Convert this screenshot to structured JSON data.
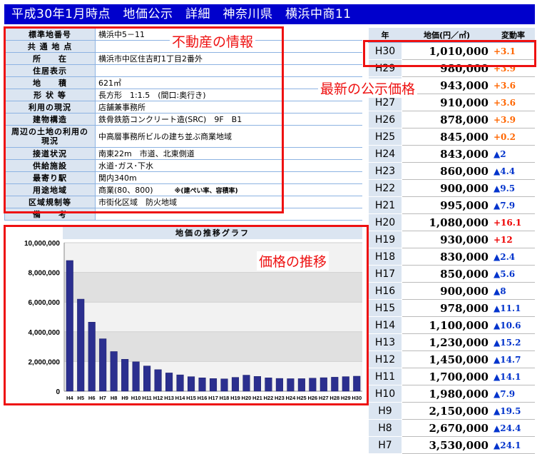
{
  "header": {
    "title": "平成30年1月時点　地価公示　詳細　神奈川県　横浜中商11"
  },
  "property": [
    {
      "label": "標準地番号",
      "value": "横浜中5－11"
    },
    {
      "label": "共 通 地 点",
      "value": ""
    },
    {
      "label": "所　　在",
      "value": "横浜市中区住吉町1丁目2番外"
    },
    {
      "label": "住居表示",
      "value": ""
    },
    {
      "label": "地　　積",
      "value": "621㎡"
    },
    {
      "label": "形 状 等",
      "value": "長方形　1:1.5　(間口:奥行き)"
    },
    {
      "label": "利用の現況",
      "value": "店舗兼事務所"
    },
    {
      "label": "建物構造",
      "value": "鉄骨鉄筋コンクリート造(SRC)　9F　B1"
    },
    {
      "label": "周辺の土地の利用の現況",
      "value": "中高層事務所ビルの建ち並ぶ商業地域"
    },
    {
      "label": "接道状況",
      "value": "南東22m　市道、北東側道"
    },
    {
      "label": "供給施設",
      "value": "水道･ガス･下水"
    },
    {
      "label": "最寄り駅",
      "value": "関内340m"
    },
    {
      "label": "用途地域",
      "value": "商業(80、800)",
      "note": "※(建ぺい率、容積率)"
    },
    {
      "label": "区域規制等",
      "value": "市街化区域　防火地域"
    },
    {
      "label": "備　　考",
      "value": ""
    }
  ],
  "price_table": {
    "headers": [
      "年",
      "地価(円／㎡)",
      "変動率"
    ],
    "rows": [
      {
        "year": "H30",
        "price": "1,010,000",
        "change": "+3.1",
        "dir": "up"
      },
      {
        "year": "H29",
        "price": "980,000",
        "change": "+3.9",
        "dir": "up"
      },
      {
        "year": "H28",
        "price": "943,000",
        "change": "+3.6",
        "dir": "up"
      },
      {
        "year": "H27",
        "price": "910,000",
        "change": "+3.6",
        "dir": "up"
      },
      {
        "year": "H26",
        "price": "878,000",
        "change": "+3.9",
        "dir": "up"
      },
      {
        "year": "H25",
        "price": "845,000",
        "change": "+0.2",
        "dir": "up"
      },
      {
        "year": "H24",
        "price": "843,000",
        "change": "▲2",
        "dir": "down"
      },
      {
        "year": "H23",
        "price": "860,000",
        "change": "▲4.4",
        "dir": "down"
      },
      {
        "year": "H22",
        "price": "900,000",
        "change": "▲9.5",
        "dir": "down"
      },
      {
        "year": "H21",
        "price": "995,000",
        "change": "▲7.9",
        "dir": "down"
      },
      {
        "year": "H20",
        "price": "1,080,000",
        "change": "+16.1",
        "dir": "upred"
      },
      {
        "year": "H19",
        "price": "930,000",
        "change": "+12",
        "dir": "upred"
      },
      {
        "year": "H18",
        "price": "830,000",
        "change": "▲2.4",
        "dir": "down"
      },
      {
        "year": "H17",
        "price": "850,000",
        "change": "▲5.6",
        "dir": "down"
      },
      {
        "year": "H16",
        "price": "900,000",
        "change": "▲8",
        "dir": "down"
      },
      {
        "year": "H15",
        "price": "978,000",
        "change": "▲11.1",
        "dir": "down"
      },
      {
        "year": "H14",
        "price": "1,100,000",
        "change": "▲10.6",
        "dir": "down"
      },
      {
        "year": "H13",
        "price": "1,230,000",
        "change": "▲15.2",
        "dir": "down"
      },
      {
        "year": "H12",
        "price": "1,450,000",
        "change": "▲14.7",
        "dir": "down"
      },
      {
        "year": "H11",
        "price": "1,700,000",
        "change": "▲14.1",
        "dir": "down"
      },
      {
        "year": "H10",
        "price": "1,980,000",
        "change": "▲7.9",
        "dir": "down"
      },
      {
        "year": "H9",
        "price": "2,150,000",
        "change": "▲19.5",
        "dir": "down"
      },
      {
        "year": "H8",
        "price": "2,670,000",
        "change": "▲24.4",
        "dir": "down"
      },
      {
        "year": "H7",
        "price": "3,530,000",
        "change": "▲24.1",
        "dir": "down"
      }
    ]
  },
  "annotations": {
    "property_info": "不動産の情報",
    "latest_price": "最新の公示価格",
    "price_trend": "価格の推移"
  },
  "colors": {
    "accent": "#0000cc",
    "header_bg": "#dbe5f1",
    "annotation": "#ee1111",
    "bar": "#2b2f8f"
  },
  "chart_data": {
    "type": "bar",
    "title": "地価の推移グラフ",
    "categories": [
      "H4",
      "H5",
      "H6",
      "H7",
      "H8",
      "H9",
      "H10",
      "H11",
      "H12",
      "H13",
      "H14",
      "H15",
      "H16",
      "H17",
      "H18",
      "H19",
      "H20",
      "H21",
      "H22",
      "H23",
      "H24",
      "H25",
      "H26",
      "H27",
      "H28",
      "H29",
      "H30"
    ],
    "values": [
      8800000,
      6200000,
      4650000,
      3530000,
      2670000,
      2150000,
      1980000,
      1700000,
      1450000,
      1230000,
      1100000,
      978000,
      900000,
      850000,
      830000,
      930000,
      1080000,
      995000,
      900000,
      860000,
      843000,
      845000,
      878000,
      910000,
      943000,
      980000,
      1010000
    ],
    "ylim": [
      0,
      10000000
    ],
    "yticks": [
      "0",
      "2,000,000",
      "4,000,000",
      "6,000,000",
      "8,000,000",
      "10,000,000"
    ],
    "grid": true
  }
}
